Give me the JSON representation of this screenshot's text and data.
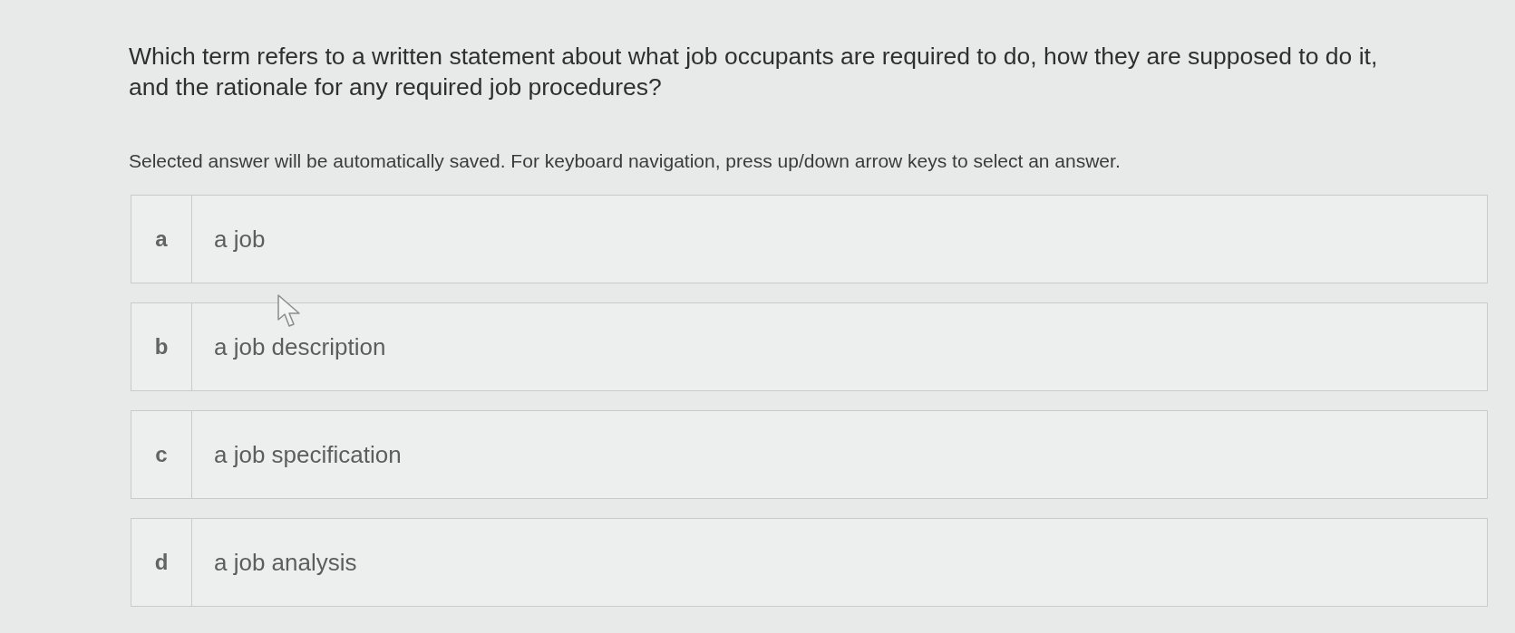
{
  "question": {
    "text": "Which term refers to a written statement about what job occupants are required to do, how they are supposed to do it, and the rationale for any required job procedures?"
  },
  "instructions": "Selected answer will be automatically saved. For keyboard navigation, press up/down arrow keys to select an answer.",
  "options": [
    {
      "letter": "a",
      "text": "a job",
      "selected": false
    },
    {
      "letter": "b",
      "text": "a job description",
      "selected": false
    },
    {
      "letter": "c",
      "text": "a job specification",
      "selected": false
    },
    {
      "letter": "d",
      "text": "a job analysis",
      "selected": false
    }
  ]
}
